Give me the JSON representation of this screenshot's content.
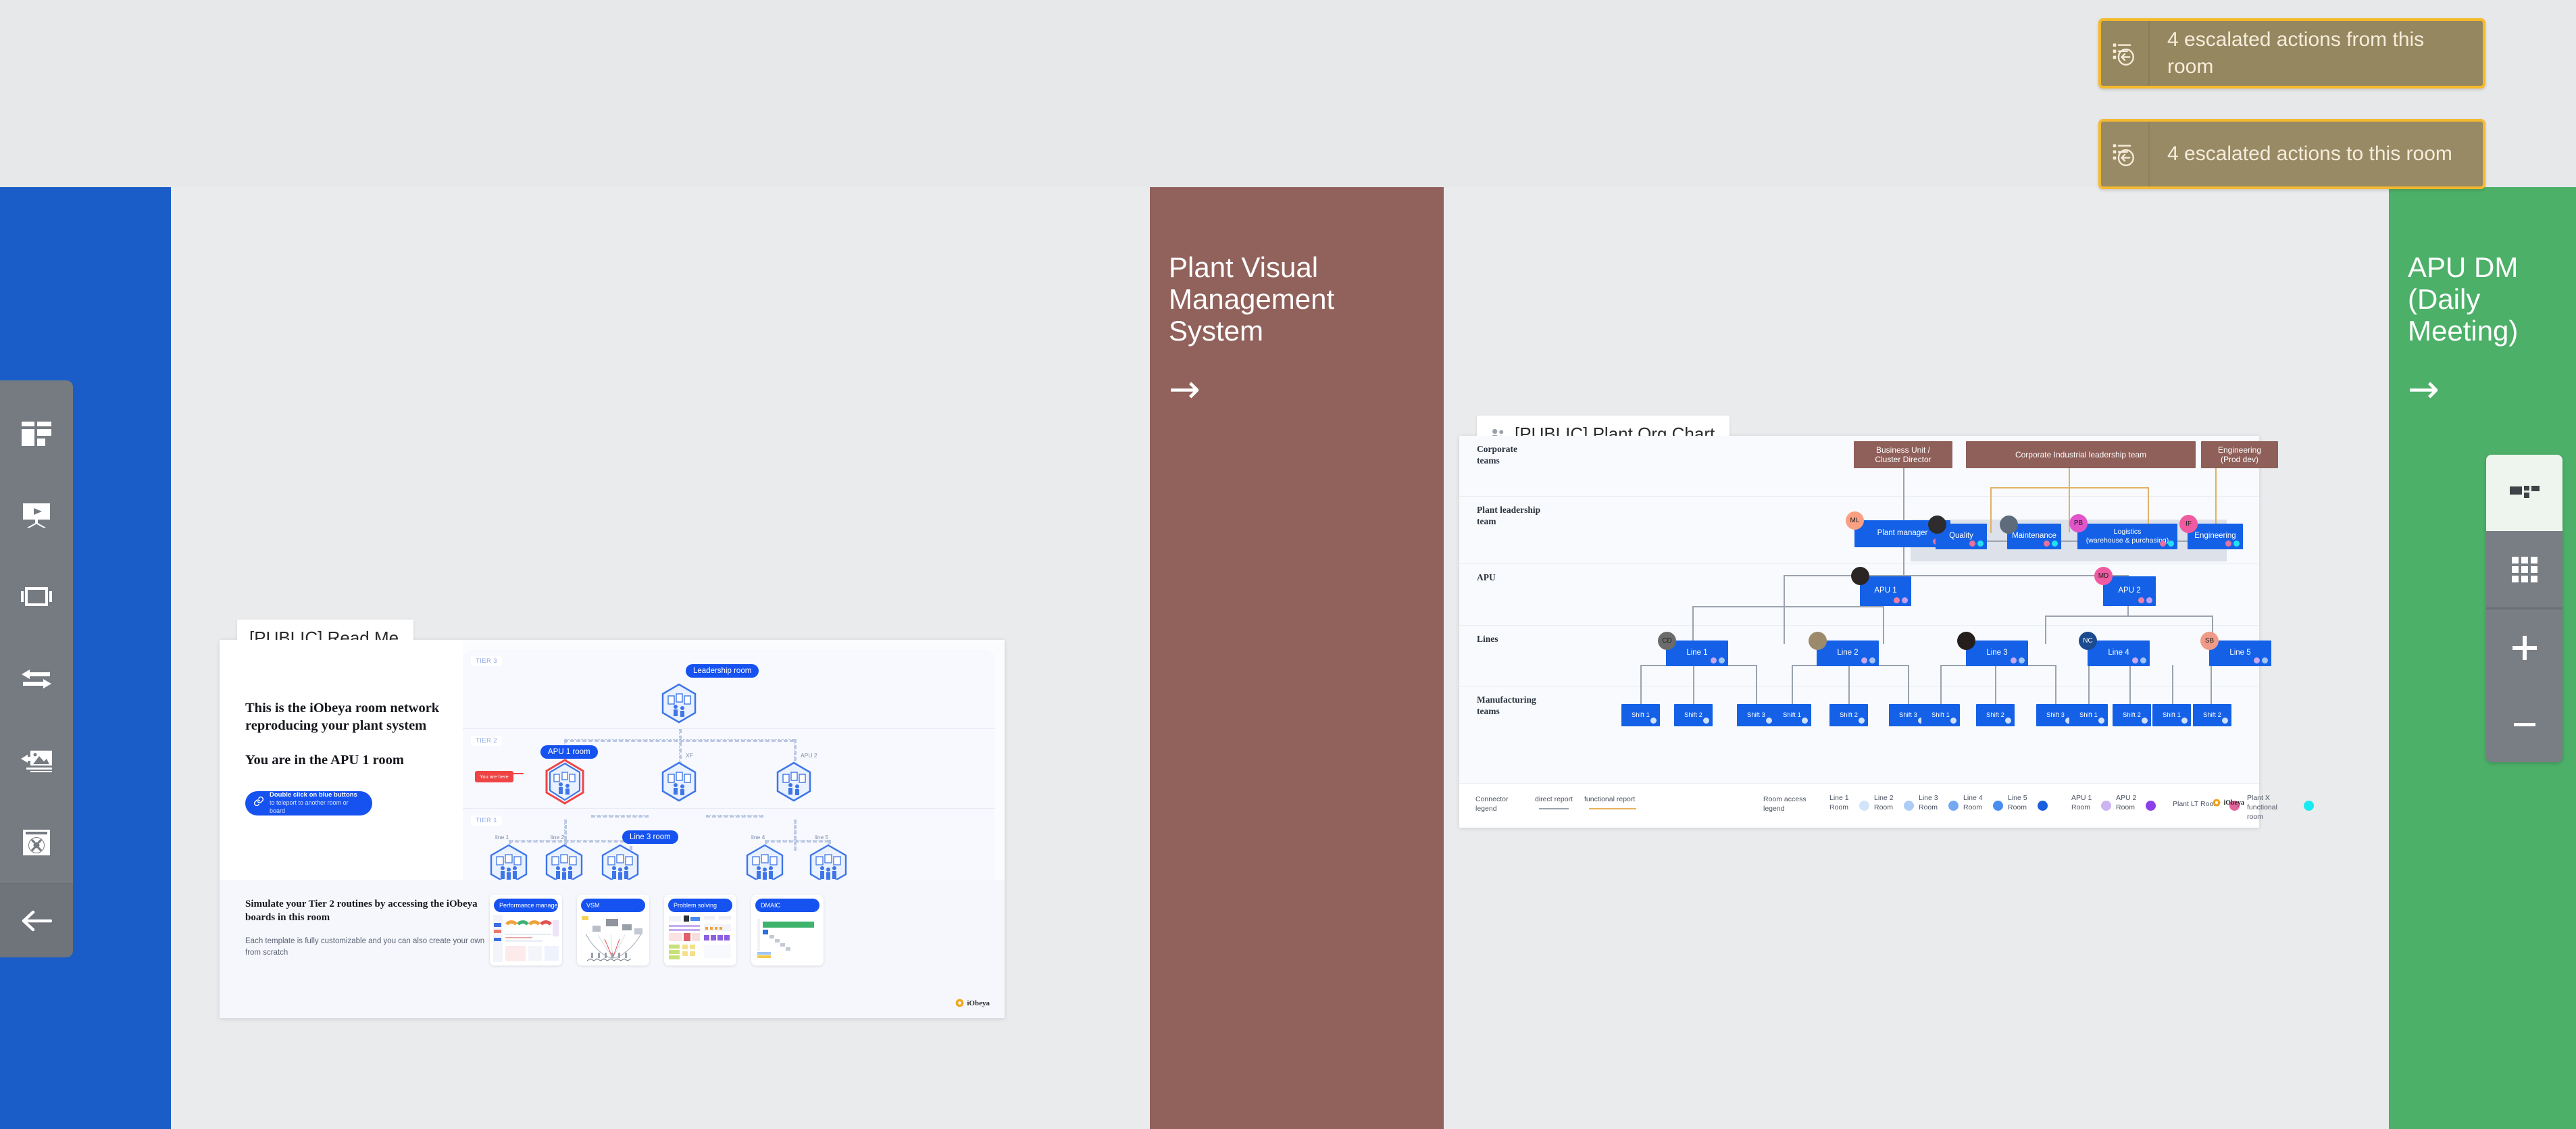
{
  "rooms": {
    "blue": {
      "color": "#1a5dc8",
      "title": ""
    },
    "brown": {
      "color": "#91615b",
      "title": "Plant Visual\nManagement\nSystem",
      "arrow": "→"
    },
    "green": {
      "color": "#4cb068",
      "title": "APU DM (Daily\nMeeting)",
      "arrow": "→"
    }
  },
  "escalations": [
    {
      "label": "4 escalated actions from this room",
      "icon": "escalation-out-icon",
      "count": 4
    },
    {
      "label": "4 escalated actions to this room",
      "icon": "escalation-in-icon",
      "count": 4
    }
  ],
  "escalation_style": {
    "fill": "#95875f",
    "border": "#f6b92a",
    "text": "#f6eddc",
    "arrow": "#f6b92a"
  },
  "left_toolbar": {
    "items": [
      {
        "name": "board-layout-icon",
        "label": "Board layout"
      },
      {
        "name": "presentation-icon",
        "label": "Presentation"
      },
      {
        "name": "carousel-icon",
        "label": "Carousel"
      },
      {
        "name": "exchange-icon",
        "label": "Exchange"
      },
      {
        "name": "insert-image-icon",
        "label": "Insert image"
      },
      {
        "name": "help-icon",
        "label": "Help"
      }
    ],
    "back": {
      "name": "back-arrow-icon",
      "label": "Back"
    }
  },
  "right_toolbar": {
    "items": [
      {
        "name": "minimap-icon",
        "label": "Minimap"
      },
      {
        "name": "grid-icon",
        "label": "Grid"
      },
      {
        "name": "zoom-in-icon",
        "label": "+"
      },
      {
        "name": "zoom-out-icon",
        "label": "−"
      }
    ]
  },
  "readme_board": {
    "tab_title": "[PUBLIC] Read Me",
    "heading_1": "This is the iObeya room network reproducing your plant system",
    "heading_2": "You are in the APU 1 room",
    "link_button": {
      "title": "Double click on blue buttons",
      "subtitle": "to teleport to another room or board",
      "icon": "link-icon"
    },
    "tiers": [
      "TIER 3",
      "TIER 2",
      "TIER 1"
    ],
    "nodes": [
      {
        "id": "leadership",
        "pill": "Leadership room",
        "tier": 3
      },
      {
        "id": "apu1",
        "pill": "APU 1 room",
        "tier": 2,
        "marker": "You are here",
        "highlight": true
      },
      {
        "id": "xf",
        "label": "XF",
        "tier": 2
      },
      {
        "id": "apu2",
        "label": "APU 2",
        "tier": 2
      },
      {
        "id": "line1",
        "label": "line 1",
        "tier": 1
      },
      {
        "id": "line2",
        "label": "line 2",
        "tier": 1
      },
      {
        "id": "line3",
        "pill": "Line 3 room",
        "tier": 1
      },
      {
        "id": "line4",
        "label": "line 4",
        "tier": 1
      },
      {
        "id": "line5",
        "label": "line 5",
        "tier": 1
      }
    ],
    "bottom_heading": "Simulate your Tier 2 routines by accessing the iObeya boards in this room",
    "bottom_text": "Each template is fully customizable and you can also create your own from scratch",
    "templates": [
      {
        "label": "Performance management"
      },
      {
        "label": "VSM"
      },
      {
        "label": "Problem solving"
      },
      {
        "label": "DMAIC"
      }
    ],
    "logo": "iObeya"
  },
  "org_board": {
    "tab_title": "[PUBLIC] Plant Org Chart",
    "tab_icon": "people-icon",
    "bands": [
      {
        "label": "Corporate\nteams"
      },
      {
        "label": "Plant leadership\nteam"
      },
      {
        "label": "APU"
      },
      {
        "label": "Lines"
      },
      {
        "label": "Manufacturing\nteams"
      }
    ],
    "nodes": {
      "corporate": [
        {
          "label": "Business Unit /\nCluster Director"
        },
        {
          "label": "Corporate Industrial leadership team"
        },
        {
          "label": "Engineering\n(Prod dev)"
        }
      ],
      "leadership": [
        {
          "label": "Plant manager",
          "avatar": "ML",
          "avatar_color": "#f9a082",
          "dots": [
            "#e4739d",
            "#23e0f0"
          ]
        },
        {
          "label": "Quality",
          "avatar": "photo",
          "avatar_color": "#3b3b3b",
          "dots": [
            "#e4739d",
            "#23e0f0"
          ]
        },
        {
          "label": "Maintenance",
          "avatar": "photo",
          "avatar_color": "#5d6b7a",
          "dots": [
            "#e4739d",
            "#23e0f0"
          ]
        },
        {
          "label": "Logistics\n(warehouse & purchasing)",
          "avatar": "PB",
          "avatar_color": "#e055c8",
          "dots": [
            "#e4739d",
            "#23e0f0"
          ]
        },
        {
          "label": "Engineering",
          "avatar": "IF",
          "avatar_color": "#ef5ba1",
          "dots": [
            "#e4739d",
            "#23e0f0"
          ]
        }
      ],
      "apu": [
        {
          "label": "APU 1",
          "avatar": "photo",
          "avatar_color": "#2b2b2b",
          "dots": [
            "#ef7fa8",
            "#c39ef0"
          ]
        },
        {
          "label": "APU 2",
          "avatar": "MD",
          "avatar_color": "#ef5ba1",
          "dots": [
            "#ef7fa8",
            "#c39ef0"
          ]
        }
      ],
      "lines": [
        {
          "label": "Line 1",
          "avatar": "CD",
          "avatar_color": "#6b6b6b",
          "dots": [
            "#c8a8ee",
            "#9fc4f5"
          ]
        },
        {
          "label": "Line 2",
          "avatar": "photo",
          "avatar_color": "#8d7c63",
          "dots": [
            "#c8a8ee",
            "#9fc4f5"
          ]
        },
        {
          "label": "Line 3",
          "avatar": "photo",
          "avatar_color": "#2a2a2a",
          "dots": [
            "#c8a8ee",
            "#9fc4f5"
          ]
        },
        {
          "label": "Line 4",
          "avatar": "NC",
          "avatar_color": "#1b4a8f",
          "dots": [
            "#c8a8ee",
            "#9fc4f5"
          ]
        },
        {
          "label": "Line 5",
          "avatar": "SB",
          "avatar_color": "#f09a88",
          "dots": [
            "#c8a8ee",
            "#9fc4f5"
          ]
        }
      ],
      "shifts": [
        {
          "line": "Line 1",
          "items": [
            "Shift 1",
            "Shift 2",
            "Shift 3"
          ]
        },
        {
          "line": "Line 2",
          "items": [
            "Shift 1",
            "Shift 2",
            "Shift 3"
          ]
        },
        {
          "line": "Line 3",
          "items": [
            "Shift 1",
            "Shift 2",
            "Shift 3"
          ]
        },
        {
          "line": "Line 4",
          "items": [
            "Shift 1",
            "Shift 2"
          ]
        },
        {
          "line": "Line 5",
          "items": [
            "Shift 1",
            "Shift 2"
          ]
        }
      ]
    },
    "legend": {
      "connector_title": "Connector\nlegend",
      "connectors": [
        {
          "label": "direct report",
          "color": "#9aa3ae"
        },
        {
          "label": "functional report",
          "color": "#e8b05c"
        }
      ],
      "room_title": "Room access\nlegend",
      "rooms": [
        {
          "label": "Line 1\nRoom",
          "color": "#d3e4fa"
        },
        {
          "label": "Line 2\nRoom",
          "color": "#aecdf6"
        },
        {
          "label": "Line 3\nRoom",
          "color": "#74a9f2"
        },
        {
          "label": "Line 4\nRoom",
          "color": "#4a8cf0"
        },
        {
          "label": "Line 5\nRoom",
          "color": "#1a5fe0"
        },
        {
          "label": "APU 1\nRoom",
          "color": "#ccb4f3"
        },
        {
          "label": "APU 2\nRoom",
          "color": "#8b3fe8"
        },
        {
          "label": "Plant LT Room",
          "color": "#e2669b"
        },
        {
          "label": "Plant X\nfunctional room",
          "color": "#19eaf0"
        }
      ]
    },
    "logo": "iObeya"
  }
}
